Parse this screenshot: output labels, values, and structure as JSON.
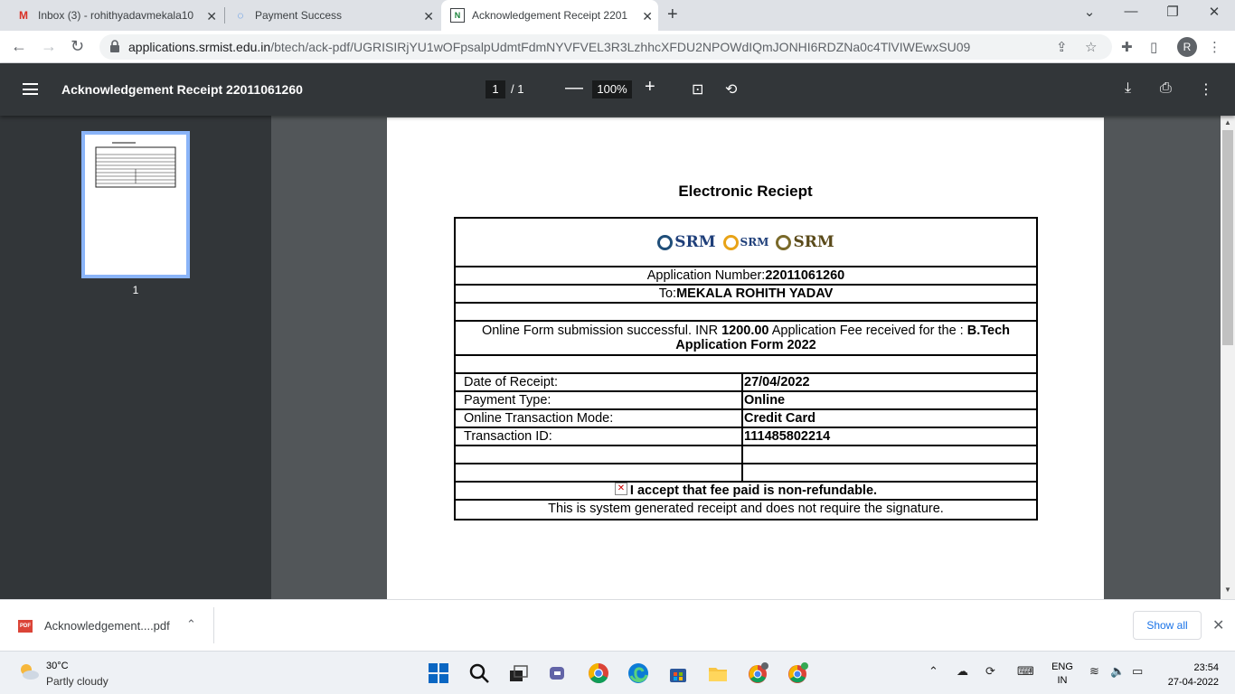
{
  "browser": {
    "tabs": [
      {
        "title": "Inbox (3) - rohithyadavmekala10",
        "icon": "gmail-icon",
        "active": false
      },
      {
        "title": "Payment Success",
        "icon": "loading-icon",
        "active": false
      },
      {
        "title": "Acknowledgement Receipt 2201",
        "icon": "page-icon",
        "active": true
      }
    ],
    "url_host": "applications.srmist.edu.in",
    "url_path": "/btech/ack-pdf/UGRISIRjYU1wOFpsalpUdmtFdmNYVFVEL3R3LzhhcXFDU2NPOWdIQmJONHI6RDZNa0c4TlVIWEwxSU09",
    "profile_initial": "R"
  },
  "pdf_viewer": {
    "title": "Acknowledgement Receipt 22011061260",
    "current_page": "1",
    "total_pages": "/ 1",
    "zoom": "100%",
    "thumbnail_number": "1"
  },
  "receipt": {
    "heading": "Electronic Reciept",
    "logos": [
      "SRM",
      "SRM",
      "SRM"
    ],
    "application_number_label": "Application Number: ",
    "application_number": "22011061260",
    "to_label": "To: ",
    "to_name": "MEKALA ROHITH YADAV",
    "message_part1": "Online Form submission successful. INR ",
    "amount": "1200.00",
    "message_part2": " Application Fee received for the : ",
    "program": "B.Tech Application Form 2022",
    "rows": [
      {
        "label": "Date of Receipt:",
        "value": "27/04/2022"
      },
      {
        "label": "Payment Type:",
        "value": "Online"
      },
      {
        "label": "Online Transaction Mode:",
        "value": "Credit Card"
      },
      {
        "label": "Transaction ID:",
        "value": "111485802214"
      }
    ],
    "accept_text": "I accept that fee paid is non-refundable.",
    "footer_text": "This is system generated receipt and does not require the signature."
  },
  "downloads": {
    "file_name": "Acknowledgement....pdf",
    "file_badge": "PDF",
    "show_all": "Show all"
  },
  "taskbar": {
    "temperature": "30°C",
    "condition": "Partly cloudy",
    "lang_top": "ENG",
    "lang_bottom": "IN",
    "time": "23:54",
    "date": "27-04-2022"
  }
}
